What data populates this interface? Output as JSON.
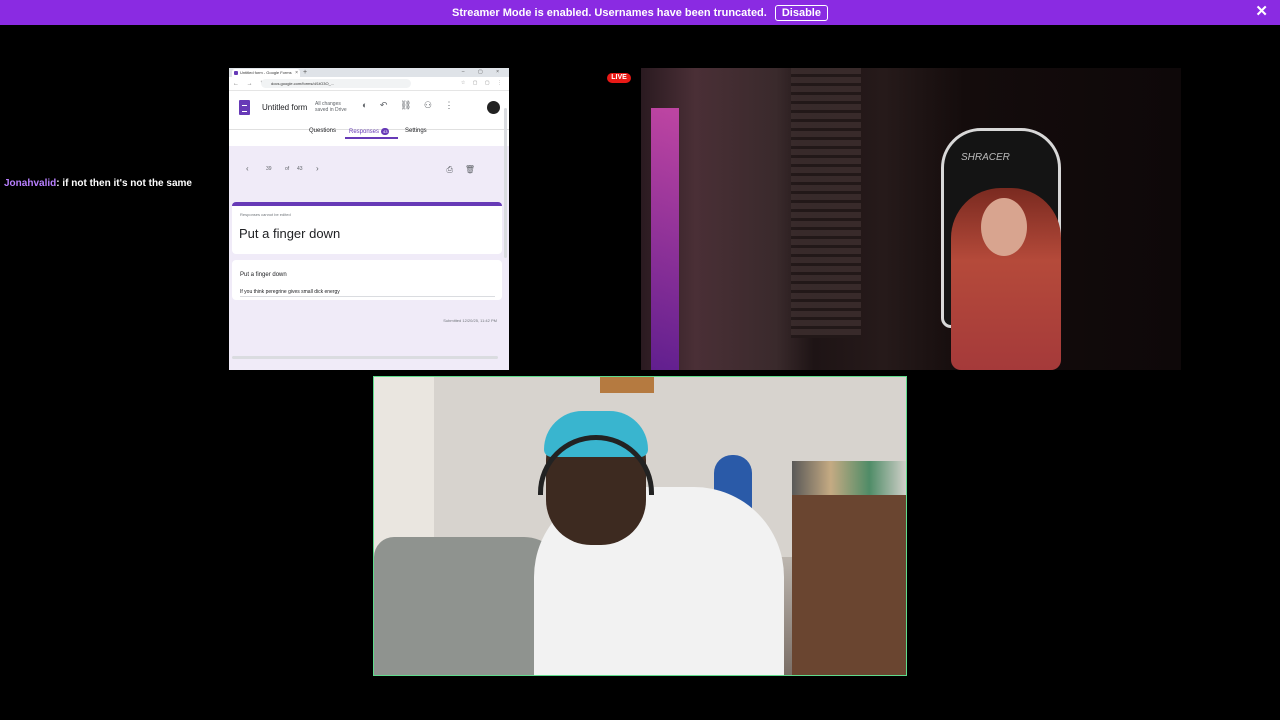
{
  "banner": {
    "message": "Streamer Mode is enabled. Usernames have been truncated.",
    "disable_label": "Disable",
    "close_glyph": "✕",
    "color": "#8a2be2"
  },
  "chat": {
    "username": "Jonahvalid",
    "message": ": if not then it's not the same"
  },
  "browser": {
    "tab_title": "Untitled form - Google Forms",
    "url": "docs.google.com/forms/d/1tO3O_..."
  },
  "form": {
    "title": "Untitled form",
    "saved_status": "All changes saved in Drive",
    "tabs": {
      "questions": "Questions",
      "responses": "Responses",
      "responses_count": "43",
      "settings": "Settings"
    },
    "pager": {
      "current": "39",
      "of": "of",
      "total": "43",
      "prev_glyph": "‹",
      "next_glyph": "›"
    },
    "note": "Responses cannot be edited",
    "response_title": "Put a finger down",
    "question": "Put a finger down",
    "answer": "If you think peregrine gives small dick energy",
    "submitted": "Submitted 12/20/25, 11:42 PM",
    "accent_color": "#673ab7"
  },
  "live_badge": "LIVE",
  "cam_top": {
    "chair_brand": "SHRACER"
  },
  "icons": [
    "close-icon",
    "prev-icon",
    "next-icon",
    "print-icon",
    "trash-icon",
    "palette-icon",
    "undo-icon",
    "link-icon",
    "add-person-icon",
    "more-icon"
  ]
}
